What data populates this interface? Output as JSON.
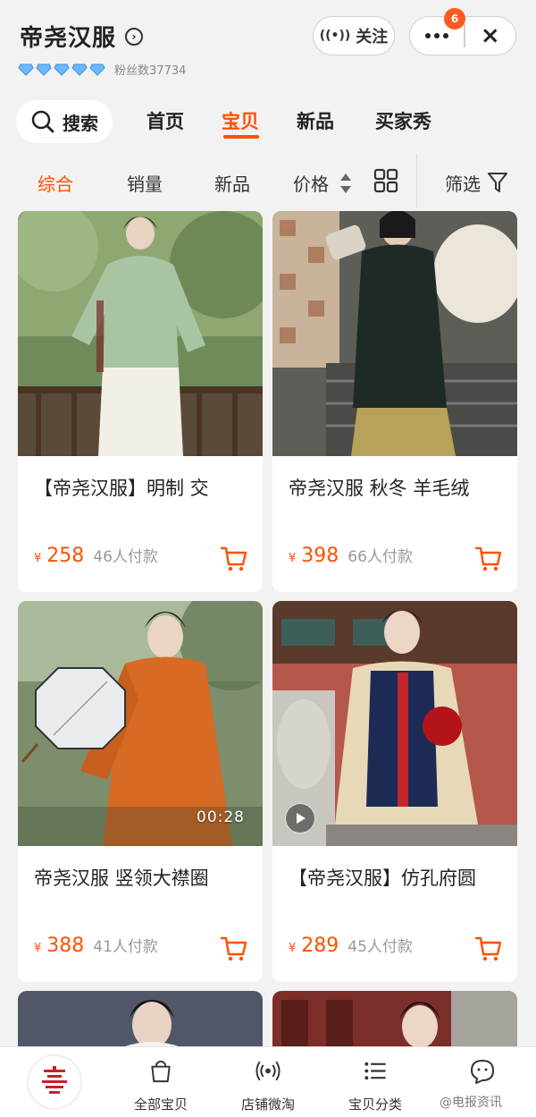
{
  "header": {
    "shop_name": "帝尧汉服",
    "fans_label": "粉丝数37734",
    "follow_label": "关注",
    "notification_count": "6",
    "close_glyph": "×"
  },
  "tabs": {
    "search_label": "搜索",
    "items": [
      "首页",
      "宝贝",
      "新品",
      "买家秀"
    ],
    "active_index": 1
  },
  "sort": {
    "items": [
      "综合",
      "销量",
      "新品",
      "价格"
    ],
    "filter_label": "筛选",
    "active_index": 0
  },
  "products": [
    {
      "title": "【帝尧汉服】明制 交",
      "yen": "¥",
      "price": "258",
      "paid": "46人付款"
    },
    {
      "title": "帝尧汉服 秋冬 羊毛绒",
      "yen": "¥",
      "price": "398",
      "paid": "66人付款"
    },
    {
      "title": "帝尧汉服 竖领大襟圈",
      "yen": "¥",
      "price": "388",
      "paid": "41人付款",
      "video_duration": "00:28"
    },
    {
      "title": "【帝尧汉服】仿孔府圆",
      "yen": "¥",
      "price": "289",
      "paid": "45人付款"
    }
  ],
  "bottom_nav": {
    "items": [
      "全部宝贝",
      "店铺微淘",
      "宝贝分类"
    ],
    "watermark": "@电报资讯"
  },
  "colors": {
    "accent": "#ff5000",
    "badge": "#ff5a1f",
    "diamond": "#6fb7ff"
  },
  "icons": {
    "verified": "circle-chevron-right-icon",
    "follow": "broadcast-icon",
    "more": "more-dots-icon",
    "close": "close-icon",
    "search": "search-icon",
    "sort_arrows": "sort-arrows-icon",
    "layout": "grid-layout-icon",
    "filter": "filter-funnel-icon",
    "cart": "cart-icon",
    "play": "play-icon",
    "all_items": "shopping-bag-icon",
    "feed": "broadcast-icon",
    "categories": "list-icon",
    "chat": "chat-face-icon"
  }
}
